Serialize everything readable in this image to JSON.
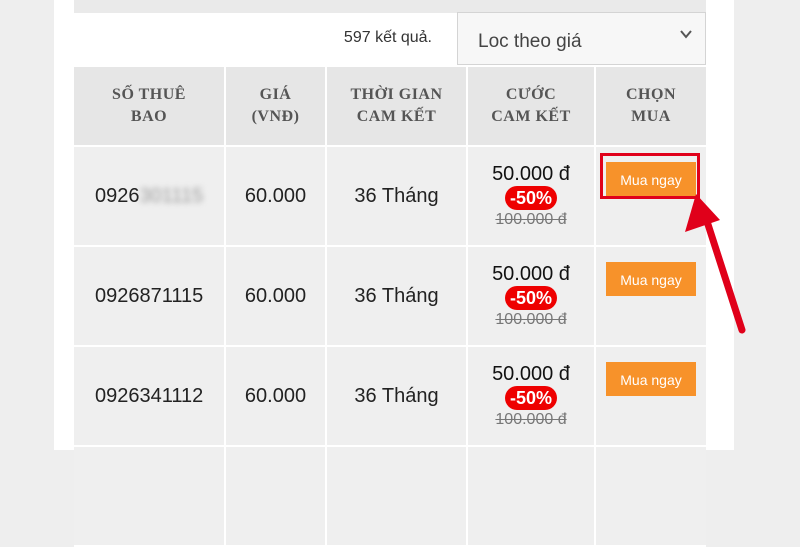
{
  "results": {
    "count_text": "597 kết quả."
  },
  "filter": {
    "label": "Loc theo giá"
  },
  "table": {
    "headers": [
      {
        "line1": "SỐ THUÊ",
        "line2": "BAO"
      },
      {
        "line1": "GIÁ",
        "line2": "(VNĐ)"
      },
      {
        "line1": "THỜI GIAN",
        "line2": "CAM KẾT"
      },
      {
        "line1": "CƯỚC",
        "line2": "CAM KẾT"
      },
      {
        "line1": "CHỌN",
        "line2": "MUA"
      }
    ],
    "rows": [
      {
        "number_visible": "0926",
        "number_hidden": "301115",
        "price": "60.000",
        "term": "36 Tháng",
        "fee": "50.000 đ",
        "discount": "-50%",
        "original": "100.000 đ",
        "buy": "Mua ngay"
      },
      {
        "number_visible": "0926871115",
        "number_hidden": "",
        "price": "60.000",
        "term": "36 Tháng",
        "fee": "50.000 đ",
        "discount": "-50%",
        "original": "100.000 đ",
        "buy": "Mua ngay"
      },
      {
        "number_visible": "0926341112",
        "number_hidden": "",
        "price": "60.000",
        "term": "36 Tháng",
        "fee": "50.000 đ",
        "discount": "-50%",
        "original": "100.000 đ",
        "buy": "Mua ngay"
      }
    ]
  },
  "icons": {
    "filter_dropdown": "chevron-down-icon",
    "annotation": "arrow-pointer-icon"
  },
  "colors": {
    "accent": "#f7922a",
    "discount": "#ee0000",
    "annotation": "#e0001a"
  }
}
